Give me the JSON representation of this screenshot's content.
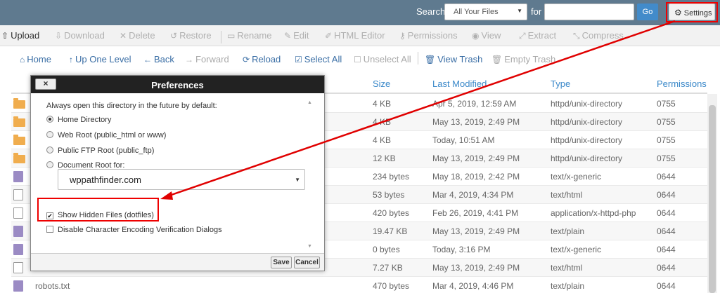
{
  "header": {
    "search_label": "Search",
    "search_scope": "All Your Files",
    "for_label": "for",
    "go_label": "Go",
    "settings_label": "Settings"
  },
  "toolbar1": [
    "Upload",
    "Download",
    "Delete",
    "Restore",
    "Rename",
    "Edit",
    "HTML Editor",
    "Permissions",
    "View",
    "Extract",
    "Compress"
  ],
  "toolbar2": [
    "Home",
    "Up One Level",
    "Back",
    "Forward",
    "Reload",
    "Select All",
    "Unselect All",
    "View Trash",
    "Empty Trash"
  ],
  "table": {
    "headers": {
      "size": "Size",
      "modified": "Last Modified",
      "type": "Type",
      "perms": "Permissions"
    },
    "rows": [
      {
        "icon": "folder",
        "name": "",
        "size": "4 KB",
        "modified": "Apr 5, 2019, 12:59 AM",
        "type": "httpd/unix-directory",
        "perms": "0755"
      },
      {
        "icon": "folder",
        "name": "",
        "size": "4 KB",
        "modified": "May 13, 2019, 2:49 PM",
        "type": "httpd/unix-directory",
        "perms": "0755"
      },
      {
        "icon": "folder",
        "name": "",
        "size": "4 KB",
        "modified": "Today, 10:51 AM",
        "type": "httpd/unix-directory",
        "perms": "0755"
      },
      {
        "icon": "folder",
        "name": "",
        "size": "12 KB",
        "modified": "May 13, 2019, 2:49 PM",
        "type": "httpd/unix-directory",
        "perms": "0755"
      },
      {
        "icon": "doc",
        "name": "",
        "size": "234 bytes",
        "modified": "May 18, 2019, 2:42 PM",
        "type": "text/x-generic",
        "perms": "0644"
      },
      {
        "icon": "code",
        "name": "",
        "size": "53 bytes",
        "modified": "Mar 4, 2019, 4:34 PM",
        "type": "text/html",
        "perms": "0644"
      },
      {
        "icon": "code",
        "name": "",
        "size": "420 bytes",
        "modified": "Feb 26, 2019, 4:41 PM",
        "type": "application/x-httpd-php",
        "perms": "0644"
      },
      {
        "icon": "doc",
        "name": "",
        "size": "19.47 KB",
        "modified": "May 13, 2019, 2:49 PM",
        "type": "text/plain",
        "perms": "0644"
      },
      {
        "icon": "doc",
        "name": "",
        "size": "0 bytes",
        "modified": "Today, 3:16 PM",
        "type": "text/x-generic",
        "perms": "0644"
      },
      {
        "icon": "code",
        "name": "",
        "size": "7.27 KB",
        "modified": "May 13, 2019, 2:49 PM",
        "type": "text/html",
        "perms": "0644"
      },
      {
        "icon": "doc",
        "name": "robots.txt",
        "size": "470 bytes",
        "modified": "Mar 4, 2019, 4:46 PM",
        "type": "text/plain",
        "perms": "0644"
      }
    ]
  },
  "modal": {
    "title": "Preferences",
    "close_label": "×",
    "intro": "Always open this directory in the future by default:",
    "options": [
      "Home Directory",
      "Web Root (public_html or www)",
      "Public FTP Root (public_ftp)",
      "Document Root for:"
    ],
    "docroot_value": "wppathfinder.com",
    "show_hidden": "Show Hidden Files (dotfiles)",
    "disable_encoding": "Disable Character Encoding Verification Dialogs",
    "save_label": "Save",
    "cancel_label": "Cancel"
  },
  "colors": {
    "header_bg": "#5f7a8f",
    "link_blue": "#3a6ea5",
    "highlight_red": "#e00000",
    "folder": "#f0ad4e"
  }
}
